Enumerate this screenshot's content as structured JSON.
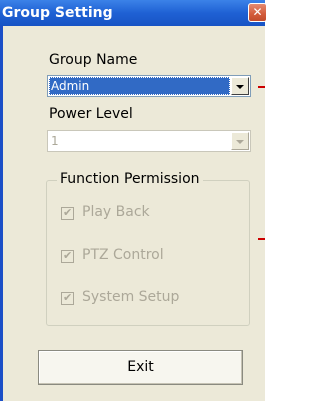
{
  "window": {
    "title": "Group Setting",
    "close_glyph": "✕"
  },
  "group_name": {
    "label": "Group Name",
    "value": "Admin"
  },
  "power_level": {
    "label": "Power Level",
    "value": "1"
  },
  "function_permission": {
    "title": "Function Permission",
    "items": [
      {
        "label": "Play Back",
        "checked": true
      },
      {
        "label": "PTZ Control",
        "checked": true
      },
      {
        "label": "System Setup",
        "checked": true
      }
    ]
  },
  "exit_label": "Exit",
  "colors": {
    "titlebar": "#1f61d4",
    "client_bg": "#ece9d8",
    "selection": "#316ac5",
    "disabled_text": "#aca899",
    "indicator": "#cc0000"
  },
  "icons": {
    "close": "close-icon",
    "dropdown": "chevron-down-icon",
    "check": "checkmark-icon"
  }
}
